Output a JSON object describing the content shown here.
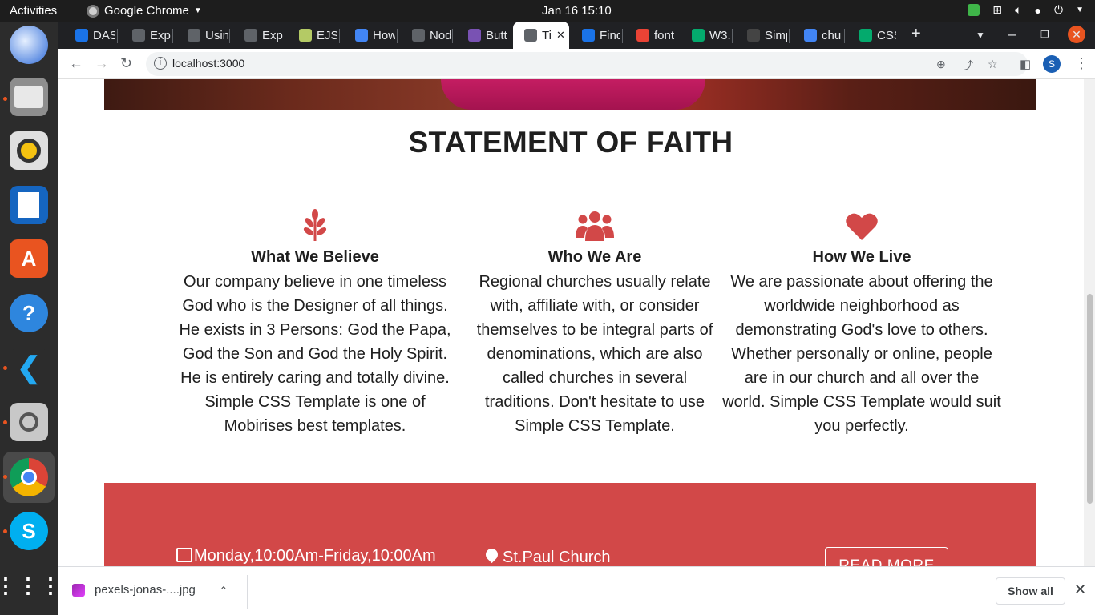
{
  "system": {
    "activities": "Activities",
    "app_name": "Google Chrome",
    "clock": "Jan 16  15:10"
  },
  "tabs": [
    {
      "label": "DAS",
      "icon": "globe-icon",
      "color": "#1a73e8"
    },
    {
      "label": "Expr",
      "icon": "express-icon",
      "color": "#5f6368"
    },
    {
      "label": "Usin",
      "icon": "ex-icon",
      "color": "#5f6368"
    },
    {
      "label": "Expr",
      "icon": "ex-icon",
      "color": "#5f6368"
    },
    {
      "label": "EJS",
      "icon": "ejs-icon",
      "color": "#b4ca65"
    },
    {
      "label": "How",
      "icon": "how-icon",
      "color": "#4285f4"
    },
    {
      "label": "Nod",
      "icon": "node-icon",
      "color": "#5f6368"
    },
    {
      "label": "Butt",
      "icon": "bootstrap-icon",
      "color": "#7952b3"
    },
    {
      "label": "Ti",
      "icon": "globe-icon",
      "color": "#5f6368",
      "active": true
    },
    {
      "label": "Find",
      "icon": "flag-icon",
      "color": "#1a73e8"
    },
    {
      "label": "font",
      "icon": "gmail-icon",
      "color": "#ea4335"
    },
    {
      "label": "W3.",
      "icon": "w3-icon",
      "color": "#04aa6d"
    },
    {
      "label": "Simp",
      "icon": "mobirise-icon",
      "color": "#444444"
    },
    {
      "label": "chur",
      "icon": "google-icon",
      "color": "#4285f4"
    },
    {
      "label": "CSS",
      "icon": "w3-icon",
      "color": "#04aa6d"
    }
  ],
  "browser": {
    "url": "localhost:3000",
    "avatar_letter": "S"
  },
  "page": {
    "section_title": "STATEMENT OF FAITH",
    "columns": [
      {
        "icon": "leaf-icon",
        "heading": "What We Believe",
        "text": "Our company believe in one timeless God who is the Designer of all things. He exists in 3 Persons: God the Papa, God the Son and God the Holy Spirit. He is entirely caring and totally divine. Simple CSS Template is one of Mobirises best templates."
      },
      {
        "icon": "users-icon",
        "heading": "Who We Are",
        "text": "Regional churches usually relate with, affiliate with, or consider themselves to be integral parts of denominations, which are also called churches in several traditions. Don't hesitate to use Simple CSS Template."
      },
      {
        "icon": "heart-icon",
        "heading": "How We Live",
        "text": "We are passionate about offering the worldwide neighborhood as demonstrating God's love to others. Whether personally or online, people are in our church and all over the world. Simple CSS Template would suit you perfectly."
      }
    ],
    "info_band": {
      "hours": "Monday,10:00Am-Friday,10:00Am",
      "location": "St.Paul Church",
      "button": "READ MORE"
    },
    "accent_color": "#d24848"
  },
  "downloads": {
    "file": "pexels-jonas-....jpg",
    "show_all": "Show all"
  }
}
